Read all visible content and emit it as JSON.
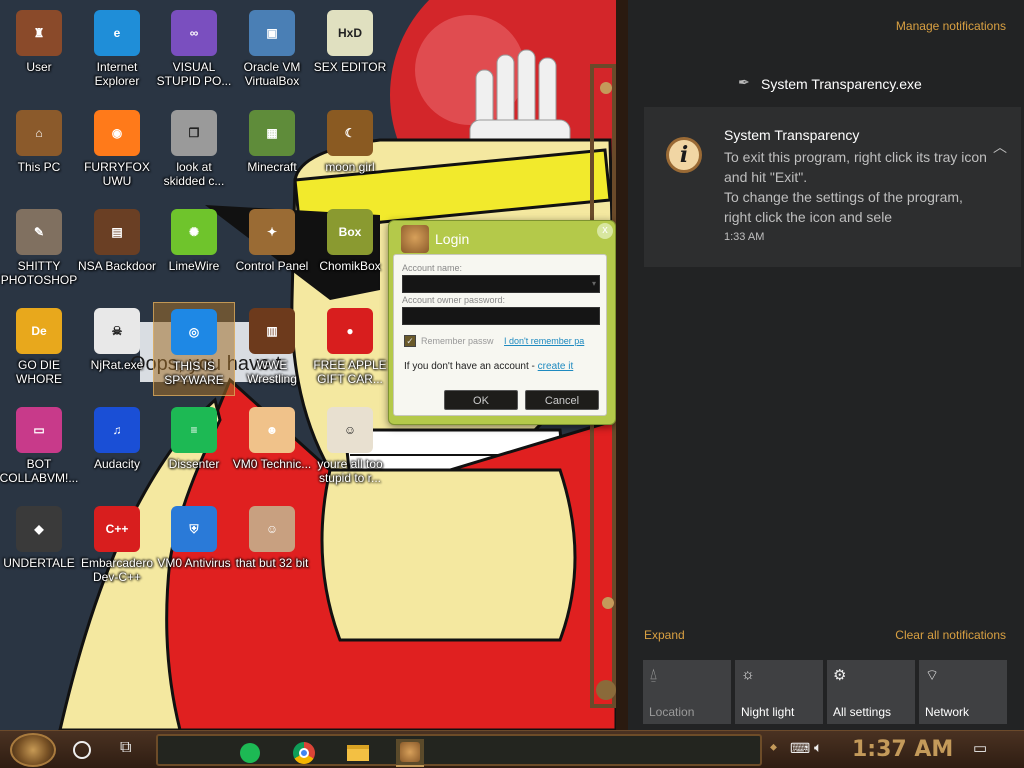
{
  "desktop": {
    "icons": [
      {
        "label": "User",
        "icon": "user-folder-icon",
        "color": "#8a4a2a"
      },
      {
        "label": "Internet Explorer",
        "icon": "edge-icon",
        "color": "#1f8ed8"
      },
      {
        "label": "VISUAL STUPID PO...",
        "icon": "visual-studio-icon",
        "color": "#7a4fbf"
      },
      {
        "label": "Oracle VM VirtualBox",
        "icon": "virtualbox-icon",
        "color": "#4a7fb5"
      },
      {
        "label": "SEX EDITOR",
        "icon": "hxd-icon",
        "color": "#e0e0c0"
      },
      {
        "label": "This PC",
        "icon": "this-pc-icon",
        "color": "#8b5a2b"
      },
      {
        "label": "FURRYFOX UWU",
        "icon": "firefox-icon",
        "color": "#ff7a1a"
      },
      {
        "label": "look at skidded c...",
        "icon": "copy-stack-icon",
        "color": "#9a9a9a"
      },
      {
        "label": "Minecraft",
        "icon": "minecraft-icon",
        "color": "#5f8c3a"
      },
      {
        "label": "moon girl",
        "icon": "moon-girl-icon",
        "color": "#8a5a22"
      },
      {
        "label": "SHITTY PHOTOSHOP",
        "icon": "gimp-icon",
        "color": "#807060"
      },
      {
        "label": "NSA Backdoor",
        "icon": "nsa-backdoor-icon",
        "color": "#6a3f24"
      },
      {
        "label": "LimeWire",
        "icon": "limewire-icon",
        "color": "#6fc42c"
      },
      {
        "label": "Control Panel",
        "icon": "control-panel-icon",
        "color": "#9a6b34"
      },
      {
        "label": "ChomikBox",
        "icon": "chomikbox-icon",
        "color": "#8a9a30"
      },
      {
        "label": "GO DIE WHORE",
        "icon": "de-icon",
        "color": "#e8a81c"
      },
      {
        "label": "NjRat.exe",
        "icon": "skull-icon",
        "color": "#e8e8e8"
      },
      {
        "label": "THIS IS SPYWARE",
        "icon": "chrome-icon",
        "color": "#1e88e5"
      },
      {
        "label": "WWE Wrestling",
        "icon": "wwe-icon",
        "color": "#6d3a1c"
      },
      {
        "label": "FREE APPLE GIFT CAR...",
        "icon": "apple-icon",
        "color": "#d81e1e"
      },
      {
        "label": "BOT COLLABVM!...",
        "icon": "monitor-icon",
        "color": "#c83a8a"
      },
      {
        "label": "Audacity",
        "icon": "audacity-icon",
        "color": "#1a4fd6"
      },
      {
        "label": "Dissenter",
        "icon": "dissenter-icon",
        "color": "#1db954"
      },
      {
        "label": "VM0 Technic...",
        "icon": "technician-icon",
        "color": "#f0c28a"
      },
      {
        "label": "youre all too stupid to r...",
        "icon": "portrait-icon",
        "color": "#e8e0d0"
      },
      {
        "label": "UNDERTALE",
        "icon": "unity-icon",
        "color": "#3a3a3a"
      },
      {
        "label": "Embarcadero Dev-C++",
        "icon": "devcpp-icon",
        "color": "#d81e1e"
      },
      {
        "label": "VM0 Antivirus",
        "icon": "shield-icon",
        "color": "#2a7ad8"
      },
      {
        "label": "that but 32 bit",
        "icon": "portrait-woman-icon",
        "color": "#c8a080"
      }
    ],
    "wallpaper_text": "Oops, you have t"
  },
  "login_dialog": {
    "title": "Login",
    "close": "x",
    "account_name_label": "Account name:",
    "password_label": "Account owner password:",
    "remember_label": "Remember passw",
    "forgot_link": "I don't remember pa",
    "no_account_text": "If you don't have an account -",
    "create_link": "create it",
    "ok": "OK",
    "cancel": "Cancel"
  },
  "action_center": {
    "manage": "Manage notifications",
    "app_name": "System Transparency.exe",
    "notification": {
      "title": "System Transparency",
      "line1": "To exit this program, right click its tray icon and hit \"Exit\".",
      "line2": "To change the settings of the program, right click the icon and sele",
      "time": "1:33 AM"
    },
    "expand": "Expand",
    "clear_all": "Clear all notifications",
    "quick_actions": [
      {
        "label": "Location",
        "icon": "location-icon",
        "enabled": false
      },
      {
        "label": "Night light",
        "icon": "night-light-icon",
        "enabled": true
      },
      {
        "label": "All settings",
        "icon": "gear-icon",
        "enabled": true
      },
      {
        "label": "Network",
        "icon": "network-icon",
        "enabled": true
      }
    ]
  },
  "taskbar": {
    "clock": "1:37 AM",
    "accent": "#c49a5a"
  }
}
